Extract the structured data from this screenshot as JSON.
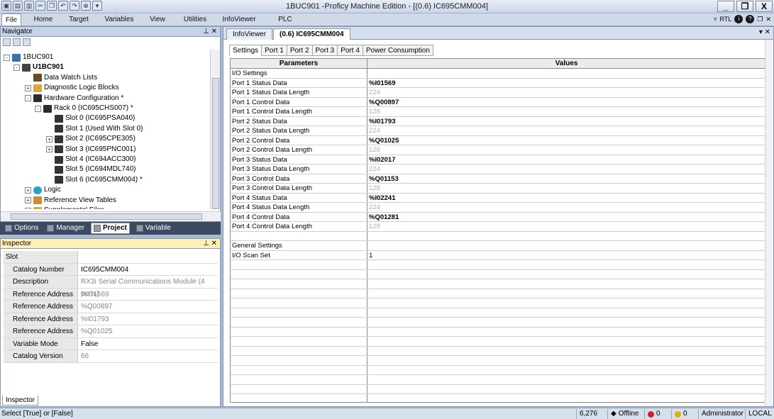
{
  "window": {
    "title": "1BUC901 -Proficy Machine Edition - [(0.6) IC695CMM004]",
    "controls": [
      "_",
      "❐",
      "X"
    ]
  },
  "menubar": {
    "items": [
      "File",
      "Home",
      "Target",
      "Variables",
      "View",
      "Utilities",
      "InfoViewer",
      "PLC HWC"
    ],
    "active": "File",
    "right_label": "RTL"
  },
  "navigator": {
    "title": "Navigator",
    "pin": "⊥ ✕",
    "tree": [
      {
        "label": "1BUC901",
        "exp": "-",
        "icon": "project",
        "bold": false
      },
      {
        "label": "U1BC901",
        "exp": "-",
        "icon": "target",
        "bold": true
      },
      {
        "label": "Data Watch Lists",
        "exp": "",
        "icon": "glasses",
        "bold": false
      },
      {
        "label": "Diagnostic Logic Blocks",
        "exp": "+",
        "icon": "folder",
        "bold": false
      },
      {
        "label": "Hardware Configuration *",
        "exp": "-",
        "icon": "hardware",
        "bold": false
      },
      {
        "label": "Rack 0 (IC695CHS007) *",
        "exp": "-",
        "icon": "rack",
        "bold": false
      },
      {
        "label": "Slot 0 (IC695PSA040)",
        "exp": "",
        "icon": "slot",
        "bold": false
      },
      {
        "label": "Slot 1 (Used With Slot 0)",
        "exp": "",
        "icon": "slot",
        "bold": false
      },
      {
        "label": "Slot 2 (IC695CPE305)",
        "exp": "+",
        "icon": "slot",
        "bold": false
      },
      {
        "label": "Slot 3 (IC695PNC001)",
        "exp": "+",
        "icon": "slot",
        "bold": false
      },
      {
        "label": "Slot 4 (IC694ACC300)",
        "exp": "",
        "icon": "slot",
        "bold": false
      },
      {
        "label": "Slot 5 (IC694MDL740)",
        "exp": "",
        "icon": "slot",
        "bold": false
      },
      {
        "label": "Slot 6 (IC695CMM004) *",
        "exp": "",
        "icon": "slot",
        "bold": false
      },
      {
        "label": "Logic",
        "exp": "+",
        "icon": "logic",
        "bold": false
      },
      {
        "label": "Reference View Tables",
        "exp": "+",
        "icon": "table",
        "bold": false
      },
      {
        "label": "Supplemental Files",
        "exp": "+",
        "icon": "folder",
        "bold": false
      }
    ]
  },
  "nav_tabs": {
    "items": [
      "Options",
      "Manager",
      "Project",
      "Variable"
    ],
    "selected": "Project"
  },
  "inspector": {
    "title": "Inspector",
    "pin": "⊥ ✕",
    "header_label": "Slot",
    "rows": [
      {
        "name": "Catalog Number",
        "value": "IC695CMM004",
        "dim": false
      },
      {
        "name": "Description",
        "value": "RX3i Serial Communications Module (4 ports)",
        "dim": true
      },
      {
        "name": "Reference Address 1",
        "value": "%I01569",
        "dim": true
      },
      {
        "name": "Reference Address 2",
        "value": "%Q00897",
        "dim": true
      },
      {
        "name": "Reference Address 3",
        "value": "%I01793",
        "dim": true
      },
      {
        "name": "Reference Address 4",
        "value": "%Q01025",
        "dim": true
      },
      {
        "name": "Variable Mode",
        "value": "False",
        "dim": false
      },
      {
        "name": "Catalog Version",
        "value": "66",
        "dim": true
      }
    ],
    "tab_label": "Inspector"
  },
  "document": {
    "tabs": [
      "InfoViewer",
      "(0.6) IC695CMM004"
    ],
    "selected_tab": "(0.6) IC695CMM004",
    "controls": "▾ ✕",
    "setting_tabs": [
      "Settings",
      "Port 1",
      "Port 2",
      "Port 3",
      "Port 4",
      "Power Consumption"
    ],
    "selected_setting_tab": "Settings",
    "grid": {
      "headers": [
        "Parameters",
        "Values"
      ],
      "rows": [
        {
          "param": "I/O Settings",
          "value": "",
          "style": ""
        },
        {
          "param": "Port 1 Status Data",
          "value": "%I01569",
          "style": "bold"
        },
        {
          "param": "Port 1 Status Data Length",
          "value": "224",
          "style": "dim"
        },
        {
          "param": "Port 1 Control Data",
          "value": "%Q00897",
          "style": "bold"
        },
        {
          "param": "Port 1 Control Data Length",
          "value": "128",
          "style": "dim"
        },
        {
          "param": "Port 2 Status Data",
          "value": "%I01793",
          "style": "bold"
        },
        {
          "param": "Port 2 Status Data Length",
          "value": "224",
          "style": "dim"
        },
        {
          "param": "Port 2 Control Data",
          "value": "%Q01025",
          "style": "bold"
        },
        {
          "param": "Port 2 Control Data Length",
          "value": "128",
          "style": "dim"
        },
        {
          "param": "Port 3 Status Data",
          "value": "%I02017",
          "style": "bold"
        },
        {
          "param": "Port 3 Status Data Length",
          "value": "224",
          "style": "dim"
        },
        {
          "param": "Port 3 Control Data",
          "value": "%Q01153",
          "style": "bold"
        },
        {
          "param": "Port 3 Control Data Length",
          "value": "128",
          "style": "dim"
        },
        {
          "param": "Port 4 Status Data",
          "value": "%I02241",
          "style": "bold"
        },
        {
          "param": "Port 4 Status Data Length",
          "value": "224",
          "style": "dim"
        },
        {
          "param": "Port 4 Control Data",
          "value": "%Q01281",
          "style": "bold"
        },
        {
          "param": "Port 4 Control Data Length",
          "value": "128",
          "style": "dim"
        },
        {
          "param": "",
          "value": "",
          "style": ""
        },
        {
          "param": "General Settings",
          "value": "",
          "style": ""
        },
        {
          "param": "I/O Scan Set",
          "value": "1",
          "style": ""
        }
      ],
      "empty_rows": 15
    }
  },
  "statusbar": {
    "hint": "Select [True] or [False]",
    "count": "6,276",
    "mode": "Offline",
    "errors": "0",
    "warnings": "0",
    "user": "Administrator",
    "location": "LOCAL"
  },
  "colors": {
    "chrome": "#cfd9e8",
    "inspector_header": "#fff1b8",
    "nav_tabs_bg": "#3b4a60",
    "error": "#d22020",
    "warning": "#e0b000"
  }
}
